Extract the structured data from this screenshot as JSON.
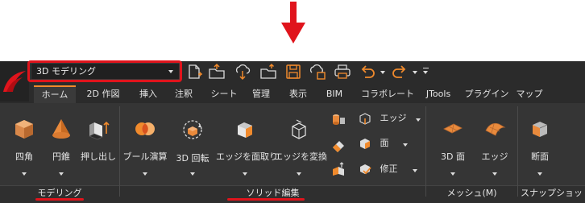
{
  "workspace": {
    "selected": "3D モデリング"
  },
  "tabs": [
    "ホーム",
    "2D 作図",
    "挿入",
    "注釈",
    "シート",
    "管理",
    "表示",
    "BIM",
    "コラボレート",
    "JTools",
    "プラグイン",
    "マップ"
  ],
  "modeling": {
    "buttons": [
      "四角",
      "円錐",
      "押し出し"
    ],
    "label": "モデリング"
  },
  "solid_edit": {
    "buttons": [
      "ブール演算",
      "3D 回転",
      "エッジを面取り",
      "エッジを変換"
    ],
    "small": [
      "エッジ",
      "面",
      "修正"
    ],
    "label": "ソリッド編集"
  },
  "mesh": {
    "buttons": [
      "3D 面",
      "エッジ"
    ],
    "label": "メッシュ(M)"
  },
  "snapshot": {
    "buttons": [
      "断面"
    ],
    "label": "スナップショット"
  },
  "colors": {
    "accent": "#f08a2c",
    "annotation": "#e0141c",
    "background": "#2b2b2b"
  }
}
